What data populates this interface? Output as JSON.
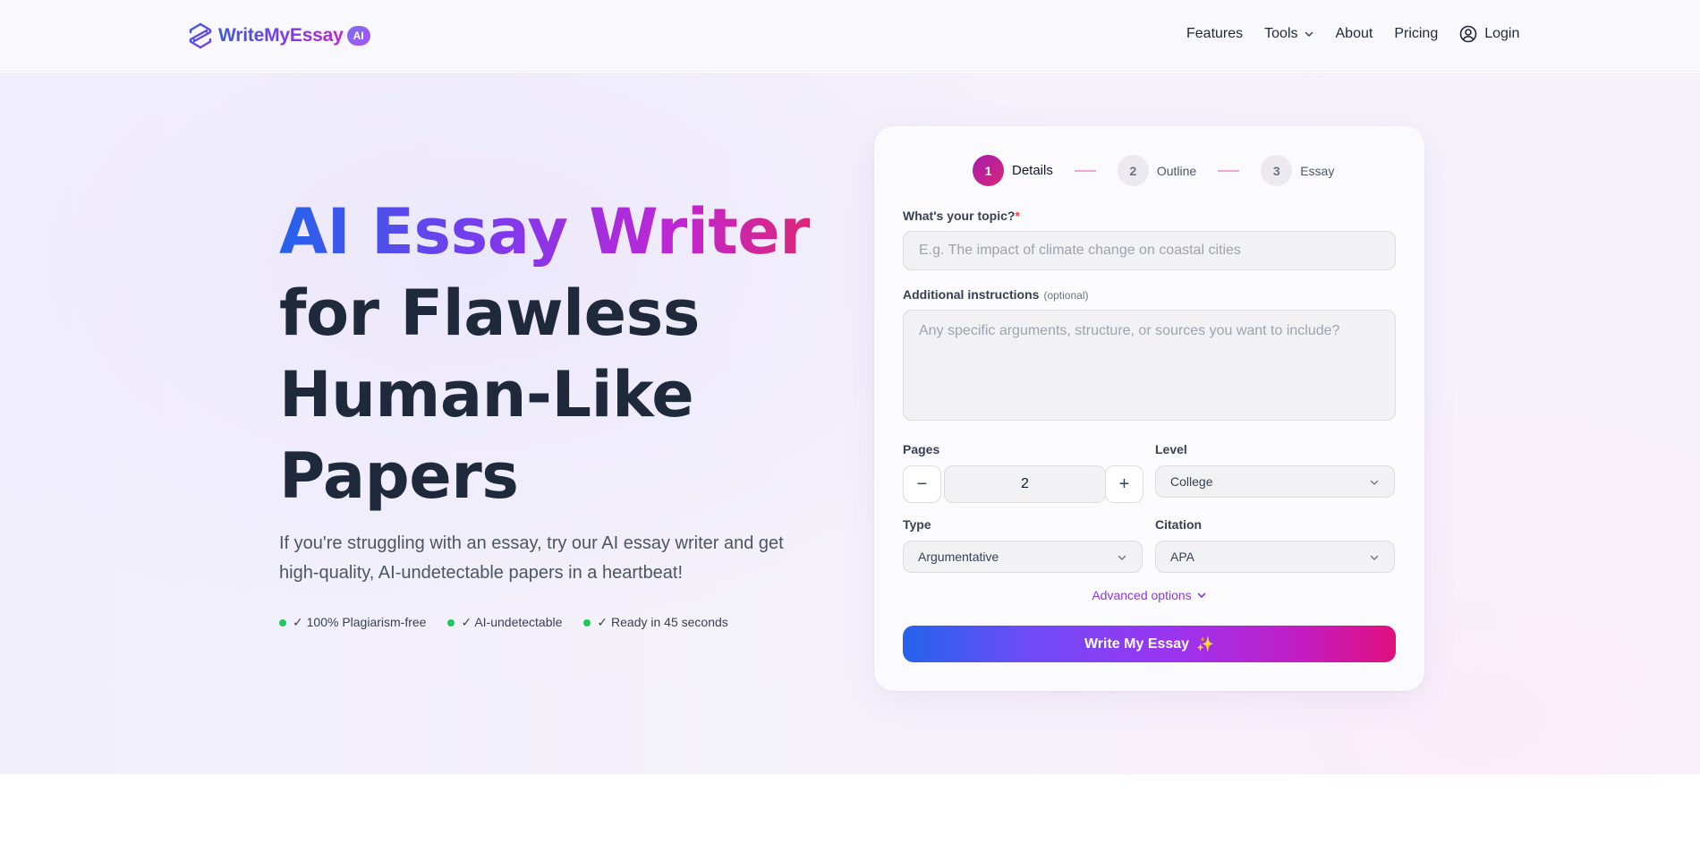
{
  "brand": {
    "name": "WriteMyEssay",
    "badge": "AI"
  },
  "nav": {
    "items": [
      "Features",
      "Tools",
      "About",
      "Pricing"
    ],
    "login": "Login"
  },
  "hero": {
    "headline_gradient": "AI Essay Writer",
    "headline_lines": [
      "for Flawless",
      "Human-Like",
      "Papers"
    ],
    "subtext": "If you're struggling with an essay, try our AI essay writer and get high-quality, AI-undetectable papers in a heartbeat!",
    "features": [
      "✓ 100% Plagiarism-free",
      "✓ AI-undetectable",
      "✓ Ready in 45 seconds"
    ]
  },
  "form": {
    "steps": [
      {
        "num": "1",
        "label": "Details"
      },
      {
        "num": "2",
        "label": "Outline"
      },
      {
        "num": "3",
        "label": "Essay"
      }
    ],
    "topic_label": "What's your topic?",
    "topic_required": "*",
    "topic_placeholder": "E.g. The impact of climate change on coastal cities",
    "instructions_label": "Additional instructions",
    "instructions_optional": "(optional)",
    "instructions_placeholder": "Any specific arguments, structure, or sources you want to include?",
    "pages_label": "Pages",
    "pages_minus": "−",
    "pages_value": "2",
    "pages_plus": "+",
    "level_label": "Level",
    "level_value": "College",
    "type_label": "Type",
    "type_value": "Argumentative",
    "citation_label": "Citation",
    "citation_value": "APA",
    "advanced_label": "Advanced options",
    "submit_label": "Write My Essay",
    "submit_sparkle": "✨"
  },
  "colors": {
    "accent_purple": "#9333ea",
    "accent_pink": "#db2777",
    "accent_blue": "#2563eb",
    "feature_dot": "#22c55e"
  }
}
